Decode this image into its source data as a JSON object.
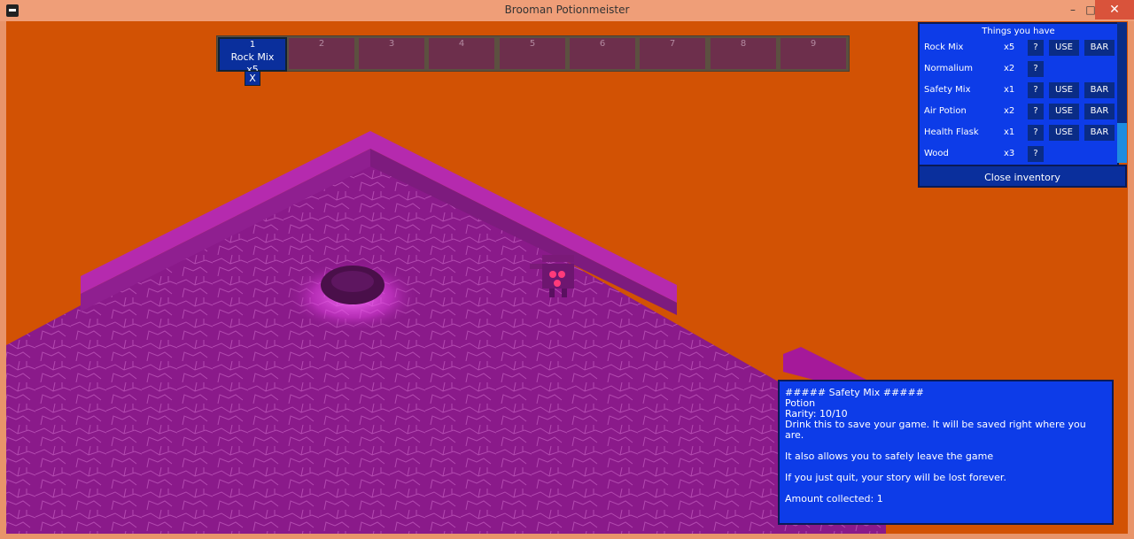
{
  "window": {
    "title": "Brooman Potionmeister",
    "minimize": "–",
    "maximize": "□",
    "close": "✕"
  },
  "hotbar": {
    "slots": [
      {
        "number": "1",
        "item": "Rock Mix",
        "qty": "x5"
      },
      {
        "number": "2"
      },
      {
        "number": "3"
      },
      {
        "number": "4"
      },
      {
        "number": "5"
      },
      {
        "number": "6"
      },
      {
        "number": "7"
      },
      {
        "number": "8"
      },
      {
        "number": "9"
      }
    ],
    "remove_label": "X"
  },
  "inventory": {
    "title": "Things you have",
    "items": [
      {
        "name": "Rock Mix",
        "qty": "x5",
        "help": "?",
        "use": "USE",
        "bar": "BAR"
      },
      {
        "name": "Normalium",
        "qty": "x2",
        "help": "?"
      },
      {
        "name": "Safety Mix",
        "qty": "x1",
        "help": "?",
        "use": "USE",
        "bar": "BAR"
      },
      {
        "name": "Air Potion",
        "qty": "x2",
        "help": "?",
        "use": "USE",
        "bar": "BAR"
      },
      {
        "name": "Health Flask",
        "qty": "x1",
        "help": "?",
        "use": "USE",
        "bar": "BAR"
      },
      {
        "name": "Wood",
        "qty": "x3",
        "help": "?"
      }
    ],
    "close_label": "Close inventory"
  },
  "description": {
    "header": "##### Safety Mix #####",
    "type": "Potion",
    "rarity": "Rarity: 10/10",
    "line1": "Drink this to save your game. It will be saved right where you are.",
    "line2": "It also allows you to safely leave the game",
    "line3": "If you just quit, your story will be lost forever.",
    "amount": "Amount collected: 1"
  },
  "colors": {
    "background": "#d25204",
    "floor": "#8a1a8a",
    "wall": "#a5199a",
    "panel": "#0d3ce8"
  }
}
